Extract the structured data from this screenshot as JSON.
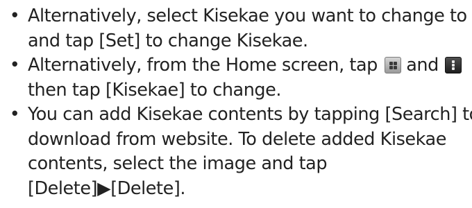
{
  "notes": [
    {
      "bullet": "•",
      "lines": [
        "Alternatively, select Kisekae you want to change to",
        "and tap [Set] to change Kisekae."
      ]
    },
    {
      "bullet": "•",
      "line1_before_apps_icon": "Alternatively, from the Home screen, tap ",
      "line1_between_icons": " and ",
      "line2": "then tap [Kisekae] to change.",
      "apps_icon": "apps-grid-icon",
      "menu_icon": "menu-icon"
    },
    {
      "bullet": "•",
      "lines": [
        "You can add Kisekae contents by tapping [Search] to",
        "download from website. To delete added Kisekae",
        "contents, select the image and tap",
        "[Delete]▶[Delete]."
      ]
    }
  ]
}
